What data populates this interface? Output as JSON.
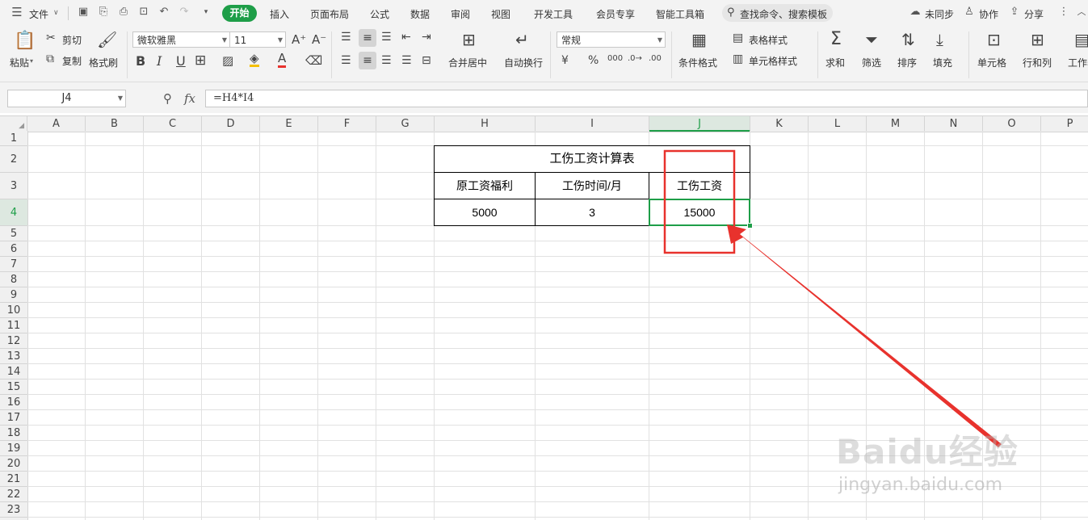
{
  "menubar": {
    "file": "文件",
    "tabs": [
      "开始",
      "插入",
      "页面布局",
      "公式",
      "数据",
      "审阅",
      "视图",
      "开发工具",
      "会员专享",
      "智能工具箱"
    ],
    "search_placeholder": "查找命令、搜索模板",
    "unsync": "未同步",
    "collab": "协作",
    "share": "分享"
  },
  "ribbon": {
    "paste": "粘贴",
    "cut": "剪切",
    "copy": "复制",
    "format_painter": "格式刷",
    "font_name": "微软雅黑",
    "font_size": "11",
    "merge_center": "合并居中",
    "auto_wrap": "自动换行",
    "number_format": "常规",
    "cond_format": "条件格式",
    "table_style": "表格样式",
    "cell_style": "单元格样式",
    "sum": "求和",
    "filter": "筛选",
    "sort": "排序",
    "fill": "填充",
    "cell": "单元格",
    "row_col": "行和列",
    "worksheet": "工作表"
  },
  "formula_bar": {
    "cell_ref": "J4",
    "fx": "fx",
    "formula": "=H4*I4"
  },
  "grid": {
    "columns": [
      "A",
      "B",
      "C",
      "D",
      "E",
      "F",
      "G",
      "H",
      "I",
      "J",
      "K",
      "L",
      "M",
      "N",
      "O",
      "P"
    ],
    "rows": [
      "1",
      "2",
      "3",
      "4",
      "5",
      "6",
      "7",
      "8",
      "9",
      "10",
      "11",
      "12",
      "13",
      "14",
      "15",
      "16",
      "17",
      "18",
      "19",
      "20",
      "21",
      "22",
      "23"
    ],
    "selected_col": "J",
    "selected_row": "4"
  },
  "table": {
    "title": "工伤工资计算表",
    "headers": [
      "原工资福利",
      "工伤时间/月",
      "工伤工资"
    ],
    "row": [
      "5000",
      "3",
      "15000"
    ]
  },
  "watermark": {
    "brand": "Baidu经验",
    "url": "jingyan.baidu.com"
  },
  "colors": {
    "accent": "#1e9e48",
    "annotation": "#e8322d"
  }
}
